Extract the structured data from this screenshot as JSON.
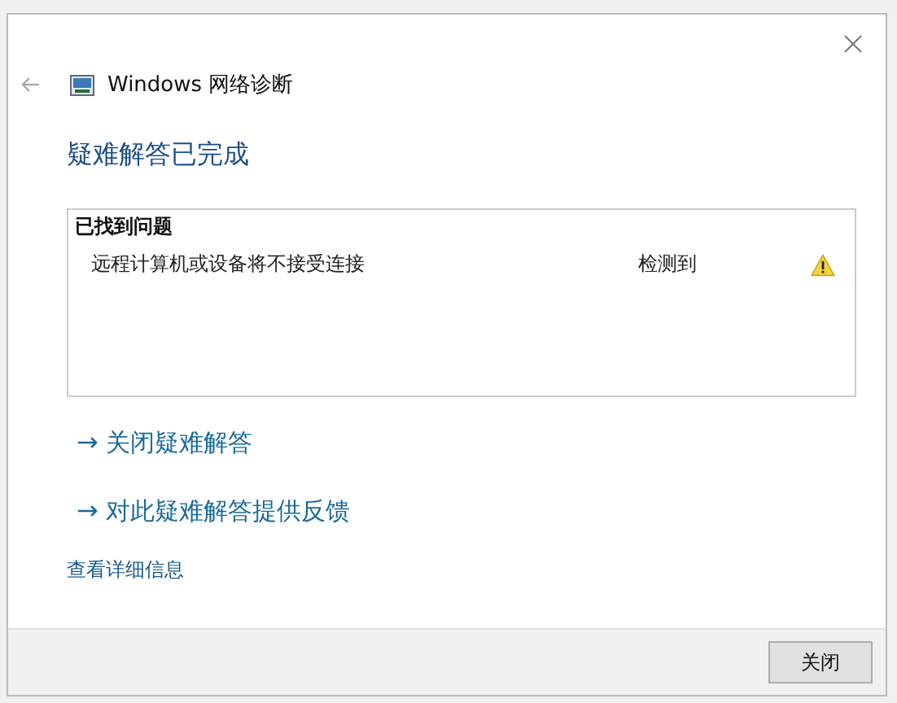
{
  "window": {
    "title": "Windows 网络诊断"
  },
  "heading": "疑难解答已完成",
  "problems": {
    "header": "已找到问题",
    "rows": [
      {
        "name": "远程计算机或设备将不接受连接",
        "status": "检测到",
        "kind": "warning"
      }
    ]
  },
  "links": [
    {
      "arrow": "→",
      "label": "关闭疑难解答"
    },
    {
      "arrow": "→",
      "label": "对此疑难解答提供反馈"
    }
  ],
  "details_link": "查看详细信息",
  "buttons": [
    "关闭"
  ]
}
